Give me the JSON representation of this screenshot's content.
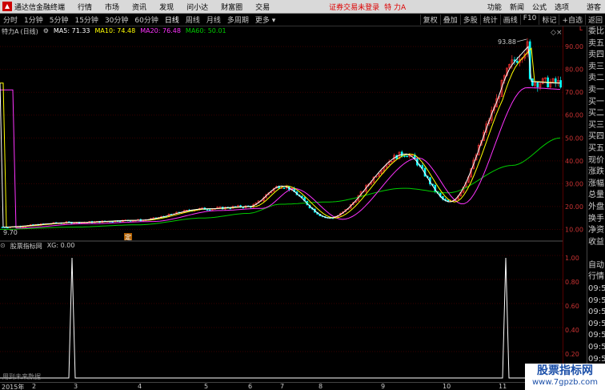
{
  "menubar": {
    "app_title": "通达信金融终端",
    "items": [
      "行情",
      "市场",
      "资讯",
      "发现",
      "问小达",
      "财富圈",
      "交易"
    ],
    "notice": "证券交易未登录",
    "stock": "特 力A",
    "right_items": [
      "功能",
      "新闻",
      "公式",
      "选项",
      "游客"
    ]
  },
  "periods": [
    "分时",
    "1分钟",
    "5分钟",
    "15分钟",
    "30分钟",
    "60分钟",
    "日线",
    "周线",
    "月线",
    "多周期",
    "更多 ▾"
  ],
  "active_period": "日线",
  "tools": [
    "复权",
    "叠加",
    "多股",
    "统计",
    "画线",
    "F10",
    "标记",
    "+自选",
    "返回"
  ],
  "ma": {
    "name": "特力A",
    "period": "(日线)",
    "ma5": "MA5: 71.33",
    "ma10": "MA10: 74.48",
    "ma20": "MA20: 76.48",
    "ma60": "MA60: 50.01",
    "colors": {
      "ma5": "#ffffff",
      "ma10": "#ffff00",
      "ma20": "#ff33ff",
      "ma60": "#00cc00"
    }
  },
  "chart_labels": {
    "high": "93.88",
    "low": "9.70",
    "marker": "定"
  },
  "price_axis": [
    "90.00",
    "80.00",
    "70.00",
    "60.00",
    "50.00",
    "40.00",
    "30.00",
    "20.00",
    "10.00"
  ],
  "indicator": {
    "name": "股票指标网",
    "label": "XG: 0.00",
    "axis": [
      "1.00",
      "0.80",
      "0.60",
      "0.40",
      "0.20"
    ],
    "nodata": "用到未来数据"
  },
  "time_axis": [
    "2015年",
    "2",
    "3",
    "4",
    "5",
    "6",
    "7",
    "8",
    "9",
    "10",
    "11"
  ],
  "right_panel": [
    "委比",
    "卖五",
    "卖四",
    "卖三",
    "卖二",
    "卖一",
    "买一",
    "买二",
    "买三",
    "买四",
    "买五",
    "现价",
    "涨跌",
    "涨幅",
    "总量",
    "外盘",
    "换手",
    "净资",
    "收益",
    "",
    "自动",
    "行情",
    "09:51",
    "09:51",
    "09:52",
    "09:52",
    "09:52",
    "09:52",
    "09:53",
    "09:53"
  ],
  "watermark": {
    "line1": "股票指标网",
    "line2": "www.7gpzb.com"
  },
  "chart_data": [
    {
      "type": "line",
      "title": "特力A (日线)",
      "ylim": [
        5,
        100
      ],
      "series": [
        {
          "name": "MA10",
          "x": [
            "2015-01",
            "2015-02",
            "2015-03",
            "2015-04",
            "2015-05",
            "2015-06",
            "2015-07",
            "2015-08",
            "2015-09",
            "2015-10",
            "2015-11"
          ],
          "values": [
            11,
            13,
            14,
            19,
            20,
            29,
            15,
            43,
            22,
            75,
            74
          ]
        },
        {
          "name": "MA60",
          "x": [
            "2015-01",
            "2015-02",
            "2015-03",
            "2015-04",
            "2015-05",
            "2015-06",
            "2015-07",
            "2015-08",
            "2015-09",
            "2015-10",
            "2015-11"
          ],
          "values": [
            10,
            11,
            12,
            15,
            17,
            21,
            22,
            28,
            26,
            38,
            50
          ]
        }
      ]
    },
    {
      "type": "line",
      "title": "XG",
      "ylim": [
        0,
        1.1
      ],
      "series": [
        {
          "name": "XG",
          "x": [
            "2015-02",
            "2015-10"
          ],
          "values": [
            1,
            1
          ]
        }
      ]
    }
  ]
}
